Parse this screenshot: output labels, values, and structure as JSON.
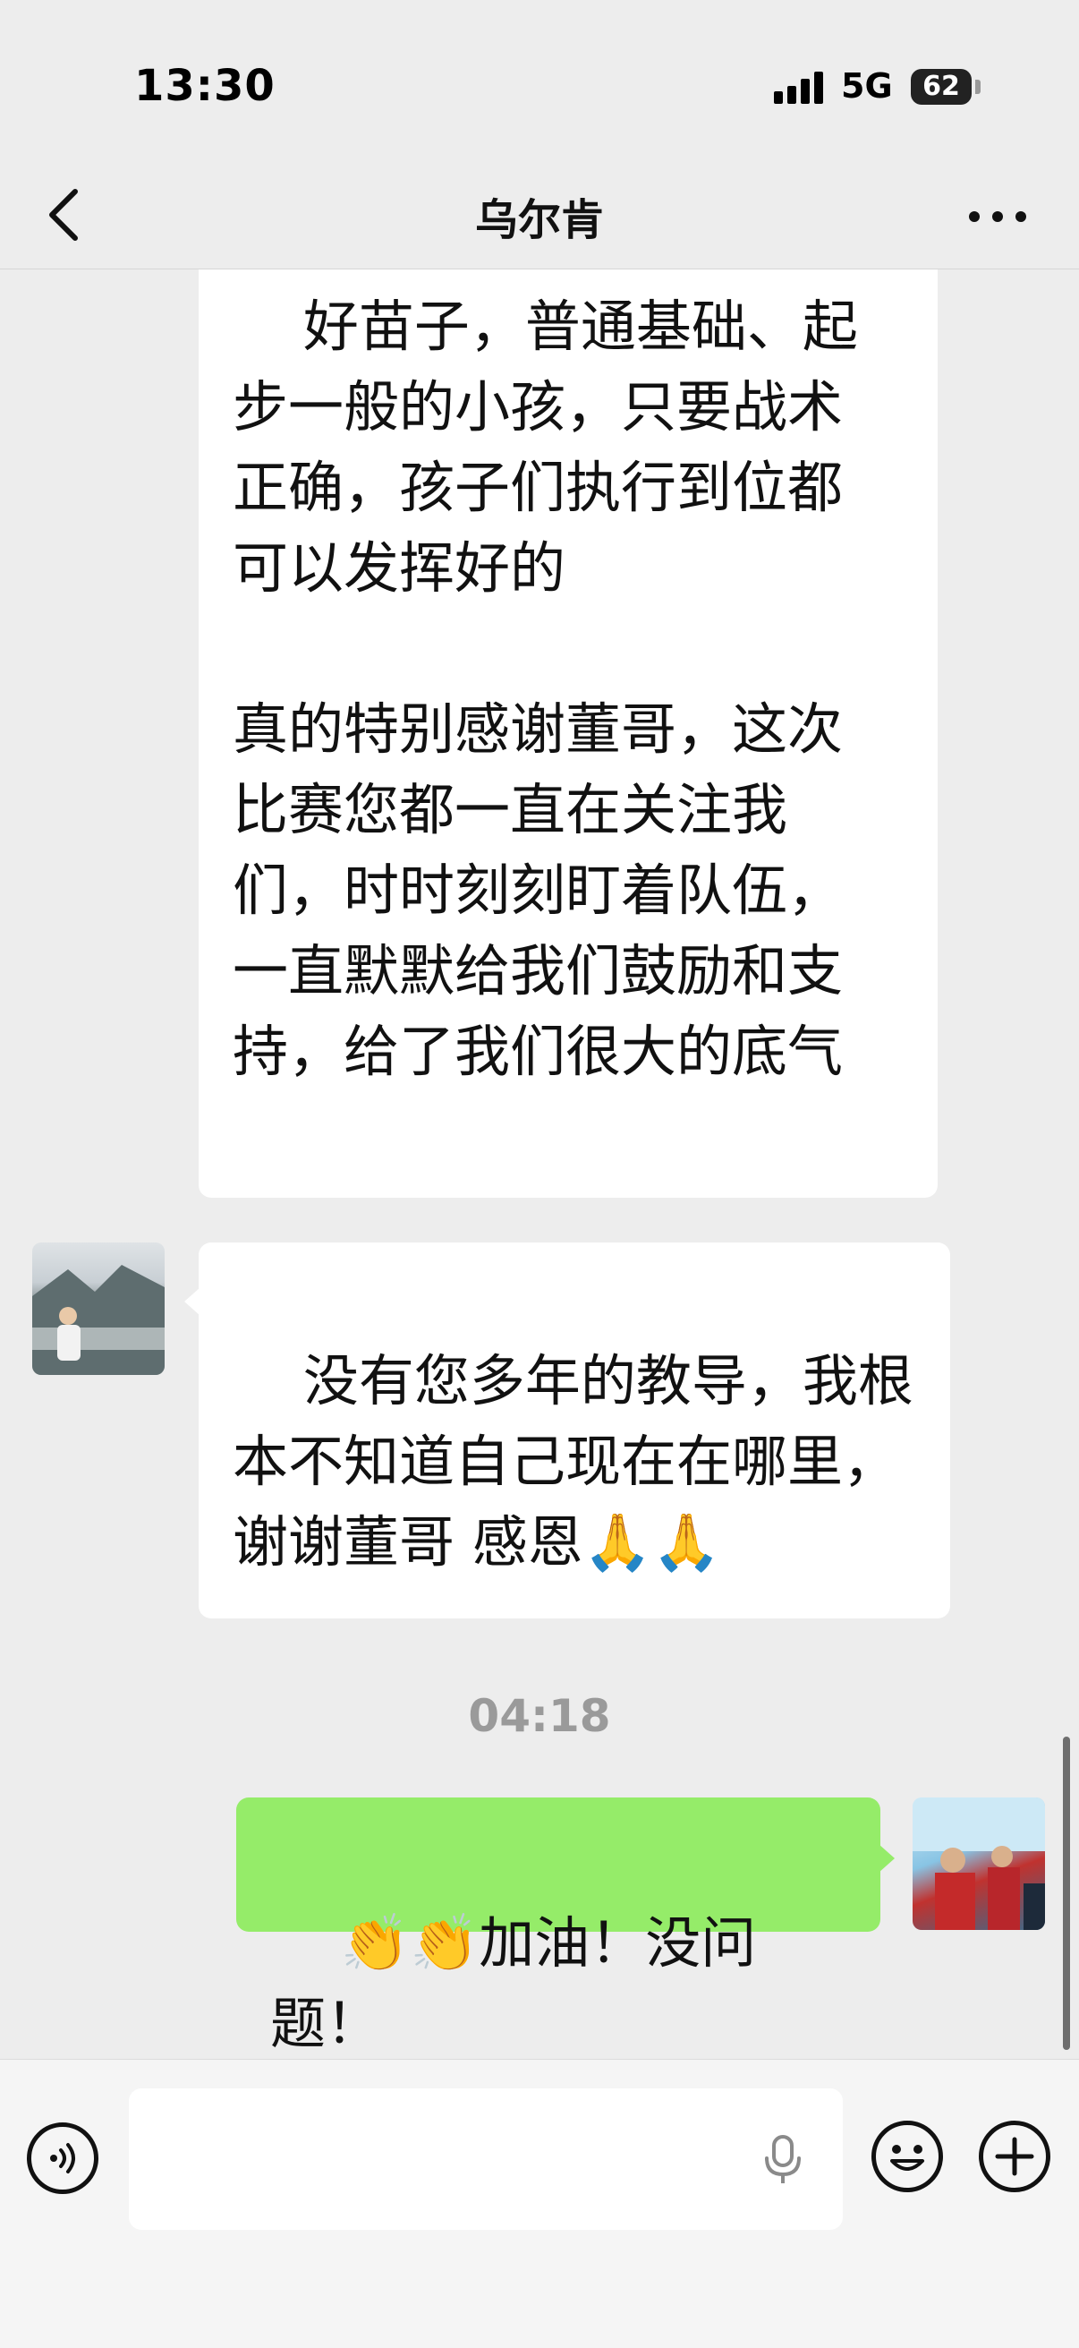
{
  "status_bar": {
    "time": "13:30",
    "network": "5G",
    "battery": "62"
  },
  "nav": {
    "title": "乌尔肯"
  },
  "messages": {
    "clipped_text": "好苗子，普通基础、起步一般的小孩，只要战术正确，孩子们执行到位都可以发挥好的\n\n真的特别感谢董哥，这次比赛您都一直在关注我们，时时刻刻盯着队伍，一直默默给我们鼓励和支持，给了我们很大的底气",
    "incoming_text": "没有您多年的教导，我根本不知道自己现在在哪里，谢谢董哥 感恩🙏🙏",
    "timestamp": "04:18",
    "outgoing_text": "👏👏加油！没问题！"
  },
  "input": {
    "placeholder": ""
  },
  "icons": {
    "back": "chevron-left-icon",
    "more": "more-dots-icon",
    "voice": "voice-icon",
    "mic": "mic-icon",
    "emoji": "emoji-icon",
    "plus": "plus-icon"
  }
}
